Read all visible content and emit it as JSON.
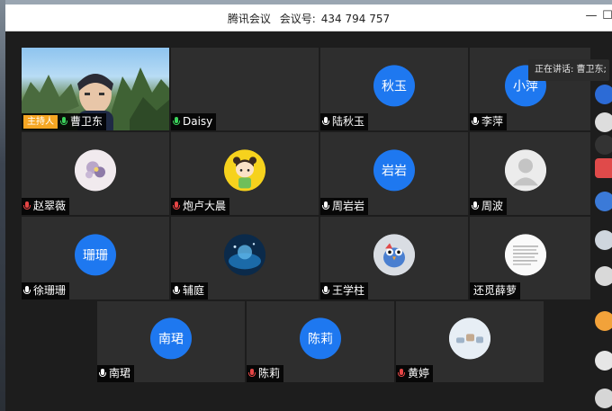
{
  "window": {
    "app_name": "腾讯会议",
    "meeting_id_label": "会议号:",
    "meeting_id": "434 794 757",
    "minimize_icon": "minimize-icon",
    "maximize_icon": "maximize-icon"
  },
  "speaking_indicator": "正在讲话: 曹卫东;",
  "host_badge": "主持人",
  "participants": [
    {
      "name": "曹卫东",
      "avatar_text": "",
      "mic": "green",
      "video": true
    },
    {
      "name": "Daisy",
      "avatar_text": "",
      "mic": "green",
      "video": false
    },
    {
      "name": "陆秋玉",
      "avatar_text": "秋玉",
      "mic": "white",
      "video": false
    },
    {
      "name": "李萍",
      "avatar_text": "小萍",
      "mic": "white",
      "video": false
    },
    {
      "name": "赵翠薇",
      "avatar_text": "",
      "mic": "muted",
      "video": false
    },
    {
      "name": "炮卢大晨",
      "avatar_text": "",
      "mic": "muted",
      "video": false
    },
    {
      "name": "周岩岩",
      "avatar_text": "岩岩",
      "mic": "white",
      "video": false
    },
    {
      "name": "周波",
      "avatar_text": "",
      "mic": "white",
      "video": false
    },
    {
      "name": "徐珊珊",
      "avatar_text": "珊珊",
      "mic": "white",
      "video": false
    },
    {
      "name": "辅庭",
      "avatar_text": "",
      "mic": "white",
      "video": false
    },
    {
      "name": "王学柱",
      "avatar_text": "",
      "mic": "white",
      "video": false
    },
    {
      "name": "还觅薛萝",
      "avatar_text": "",
      "mic": "none",
      "video": false
    },
    {
      "name": "南珺",
      "avatar_text": "南珺",
      "mic": "white",
      "video": false
    },
    {
      "name": "陈莉",
      "avatar_text": "陈莉",
      "mic": "muted",
      "video": false
    },
    {
      "name": "黄婷",
      "avatar_text": "",
      "mic": "muted",
      "video": false
    }
  ],
  "colors": {
    "avatar_blue": "#1e78f0",
    "tile_bg": "#2e2e2e",
    "host_badge": "#f5a623",
    "mic_active": "#3bd35b",
    "mic_muted": "#e64545"
  }
}
